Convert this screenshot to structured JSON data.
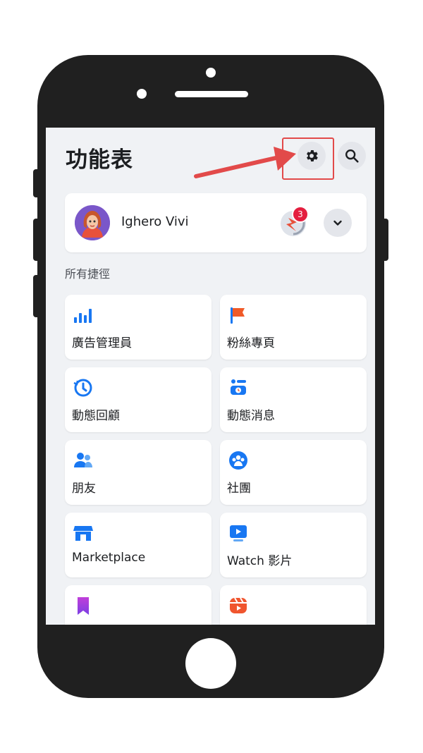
{
  "app": {
    "title": "功能表"
  },
  "header": {
    "settings_icon": "gear-icon",
    "search_icon": "search-icon"
  },
  "profile": {
    "name": "Ighero Vivi",
    "story_badge": "3"
  },
  "shortcuts": {
    "label": "所有捷徑",
    "items": [
      {
        "label": "廣告管理員",
        "icon": "bar-chart-icon"
      },
      {
        "label": "粉絲專頁",
        "icon": "flag-icon"
      },
      {
        "label": "動態回顧",
        "icon": "clock-icon"
      },
      {
        "label": "動態消息",
        "icon": "feed-icon"
      },
      {
        "label": "朋友",
        "icon": "friends-icon"
      },
      {
        "label": "社團",
        "icon": "groups-icon"
      },
      {
        "label": "Marketplace",
        "icon": "store-icon"
      },
      {
        "label": "Watch 影片",
        "icon": "video-icon"
      },
      {
        "label": "",
        "icon": "bookmark-icon"
      },
      {
        "label": "",
        "icon": "reels-icon"
      }
    ]
  },
  "colors": {
    "highlight": "#e24a4a",
    "brand": "#1877f2",
    "badge": "#e41e3f"
  }
}
